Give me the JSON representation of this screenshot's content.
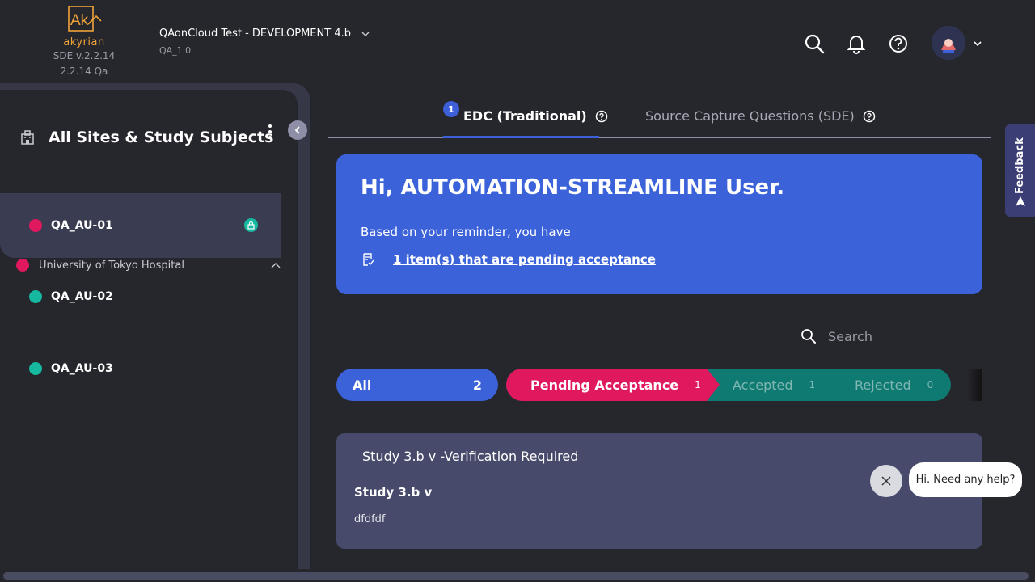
{
  "header": {
    "logo_text": "Ak",
    "brand": "akyrian",
    "version_line1": "SDE v.2.2.14",
    "version_line2": "2.2.14 Qa",
    "study_name": "QAonCloud Test - DEVELOPMENT 4.b",
    "study_sub": "QA_1.0",
    "icons": [
      "search-icon",
      "bell-icon",
      "help-icon",
      "avatar",
      "chevron-down-icon"
    ]
  },
  "sidebar": {
    "title": "All Sites & Study Subjects",
    "site": {
      "name": "University of Tokyo Hospital",
      "status_color": "#e0185e"
    },
    "subjects": [
      {
        "label": "QA_AU-01",
        "status_color": "#e0185e"
      },
      {
        "label": "QA_AU-02",
        "status_color": "#17b8a0"
      },
      {
        "label": "QA_AU-03",
        "status_color": "#17b8a0"
      }
    ]
  },
  "tabs": [
    {
      "label": "EDC (Traditional)",
      "badge": "1"
    },
    {
      "label": "Source Capture Questions (SDE)"
    }
  ],
  "greeting": {
    "title": "Hi, AUTOMATION-STREAMLINE User.",
    "text": "Based on your reminder, you have",
    "link": "1 item(s) that are pending acceptance"
  },
  "search": {
    "placeholder": "Search"
  },
  "filters": {
    "all": {
      "label": "All",
      "count": "2"
    },
    "pending": {
      "label": "Pending Acceptance",
      "count": "1"
    },
    "accepted": {
      "label": "Accepted",
      "count": "1"
    },
    "rejected": {
      "label": "Rejected",
      "count": "0"
    }
  },
  "card": {
    "header": "Study 3.b v -Verification Required",
    "title": "Study 3.b v",
    "body": "dfdfdf"
  },
  "chat": {
    "prompt": "Hi. Need any help?"
  },
  "feedback": {
    "label": "Feedback"
  },
  "colors": {
    "accent": "#3b62d9",
    "pending": "#e0185e",
    "accepted": "#0f7a72",
    "teal": "#17b8a0"
  }
}
